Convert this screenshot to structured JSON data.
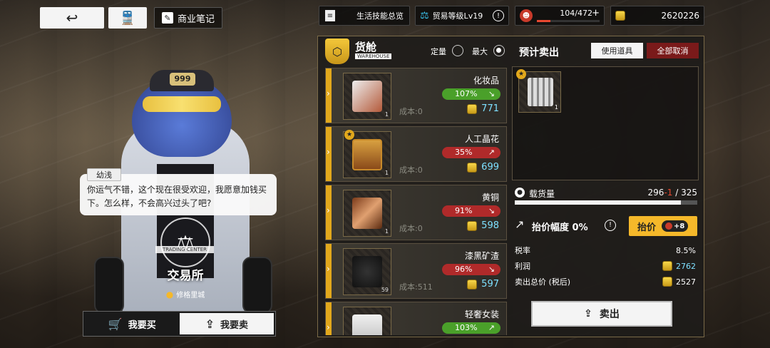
{
  "topbar": {
    "back_icon": "↩",
    "train_icon": "🚆",
    "notes_label": "商业笔记",
    "life_skills_label": "生活技能总览",
    "trade_level_label": "贸易等级Lv19",
    "stamina_value": "104/472",
    "stamina_fill_fraction": 0.22,
    "money": "2620226"
  },
  "npc": {
    "name": "幼浅",
    "dialog": "你运气不错，这个现在很受欢迎，我愿意加钱买下。怎么样，不会高兴过头了吧?",
    "emblem_caption": "TRADING CENTER",
    "cap_text": "999"
  },
  "exchange": {
    "title": "交易所",
    "location": "修格里城"
  },
  "mode": {
    "buy_label": "我要买",
    "sell_label": "我要卖"
  },
  "cargo": {
    "title": "货舱",
    "subtitle": "WAREHOUSE",
    "fixed_label": "定量",
    "max_label": "最大",
    "predicted_title": "预计卖出",
    "use_item_label": "使用道具",
    "cancel_all_label": "全部取消",
    "items": [
      {
        "name": "化妆品",
        "pct": "107%",
        "trend": "down",
        "cost": "成本:0",
        "price": "771",
        "qty": "1",
        "star": false
      },
      {
        "name": "人工晶花",
        "pct": "35%",
        "trend": "up",
        "cost": "成本:0",
        "price": "699",
        "qty": "1",
        "star": true
      },
      {
        "name": "黄铜",
        "pct": "91%",
        "trend": "down",
        "cost": "成本:0",
        "price": "598",
        "qty": "1",
        "star": false
      },
      {
        "name": "漆黑矿渣",
        "pct": "96%",
        "trend": "down",
        "cost": "成本:511",
        "price": "597",
        "qty": "59",
        "star": false
      },
      {
        "name": "轻奢女装",
        "pct": "103%",
        "trend": "up",
        "cost": "",
        "price": "",
        "qty": "",
        "star": false
      }
    ],
    "sale_item_qty": "1",
    "load_label": "载货量",
    "load_current": "296",
    "load_delta": "-1",
    "load_max": "/ 325",
    "load_fraction": 0.91,
    "raise_label": "抬价幅度 0%",
    "raise_button": "抬价",
    "raise_cost": "+8",
    "tax_label": "税率",
    "tax_value": "8.5%",
    "profit_label": "利润",
    "profit_value": "2762",
    "total_label": "卖出总价 (税后)",
    "total_value": "2527",
    "sell_button": "卖出"
  }
}
